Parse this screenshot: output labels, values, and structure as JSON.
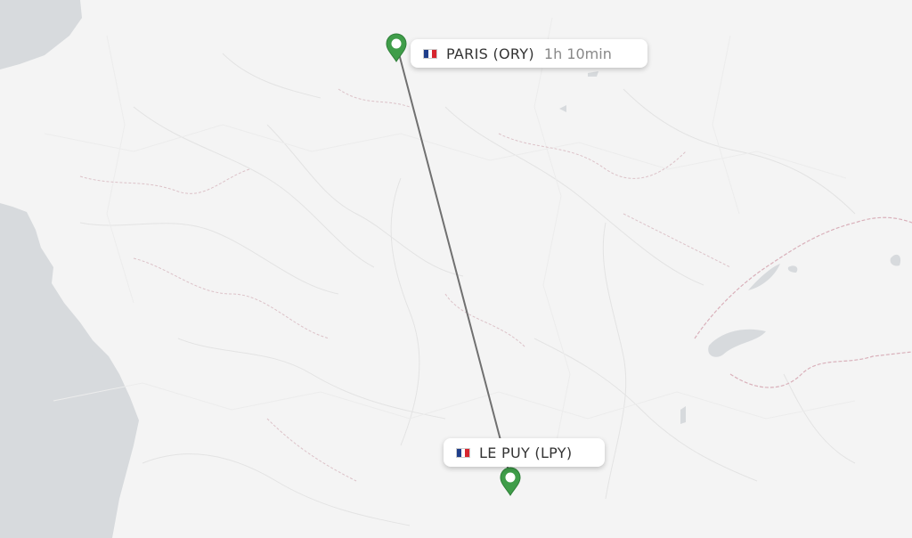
{
  "map": {
    "colors": {
      "land": "#f4f4f4",
      "water": "#d7dadd",
      "route": "#707070",
      "pin": "#3f9d49"
    },
    "origin": {
      "label": "PARIS (ORY)",
      "duration": "1h 10min",
      "flag_colors": [
        "#1f3e8a",
        "#ffffff",
        "#d6262f"
      ],
      "marker_icon": "map-pin-icon"
    },
    "destination": {
      "label": "LE PUY (LPY)",
      "flag_colors": [
        "#1f3e8a",
        "#ffffff",
        "#d6262f"
      ],
      "marker_icon": "map-pin-icon"
    }
  }
}
